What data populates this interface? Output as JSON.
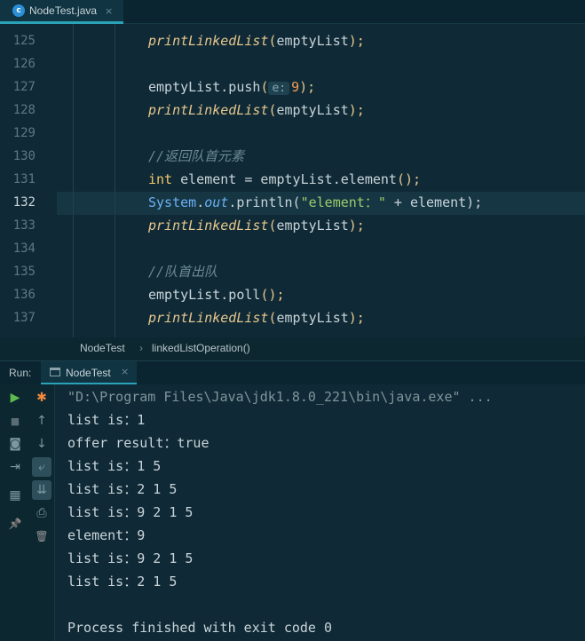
{
  "file_tab": {
    "icon": "c",
    "label": "NodeTest.java",
    "close": "×"
  },
  "editor": {
    "line_numbers": [
      "125",
      "126",
      "127",
      "128",
      "129",
      "130",
      "131",
      "132",
      "133",
      "134",
      "135",
      "136",
      "137"
    ],
    "current_line": "132",
    "lines": {
      "l125": {
        "method": "printLinkedList",
        "open": "(",
        "arg": "emptyList",
        "close": ");"
      },
      "l127": {
        "pre": "emptyList.push",
        "open": "(",
        "hint": "e:",
        "num": "9",
        "close": ");"
      },
      "l128": {
        "method": "printLinkedList",
        "open": "(",
        "arg": "emptyList",
        "close": ");"
      },
      "l130": {
        "comment": "//返回队首元素"
      },
      "l131": {
        "kw": "int",
        "rest": " element = emptyList.element",
        "paren": "();"
      },
      "l132": {
        "cls": "System",
        "dot1": ".",
        "fld": "out",
        "mid": ".println(",
        "str": "\"element：\"",
        "tail": " + element);"
      },
      "l133": {
        "method": "printLinkedList",
        "open": "(",
        "arg": "emptyList",
        "close": ");"
      },
      "l135": {
        "comment": "//队首出队"
      },
      "l136": {
        "pre": "emptyList.poll",
        "paren": "();"
      },
      "l137": {
        "method": "printLinkedList",
        "open": "(",
        "arg": "emptyList",
        "close": ");"
      }
    }
  },
  "breadcrumb": {
    "class": "NodeTest",
    "sep": "›",
    "method": "linkedListOperation()"
  },
  "run_panel": {
    "label": "Run:",
    "tab": "NodeTest",
    "close": "×",
    "console_lines": [
      "\"D:\\Program Files\\Java\\jdk1.8.0_221\\bin\\java.exe\" ...",
      "list is：1",
      "offer result：true",
      "list is：1 5",
      "list is：2 1 5",
      "list is：9 2 1 5",
      "element：9",
      "list is：9 2 1 5",
      "list is：2 1 5",
      "",
      "Process finished with exit code 0"
    ]
  },
  "icons": {
    "rerun": "▶",
    "stop": "■",
    "camera": "◙",
    "login": "⇥",
    "layout": "▦",
    "pin": "📌",
    "debug": "✱",
    "up": "↑",
    "down": "↓",
    "wrap": "⤶",
    "scroll_end": "⇊",
    "print": "⎙",
    "trash": "🗑"
  }
}
